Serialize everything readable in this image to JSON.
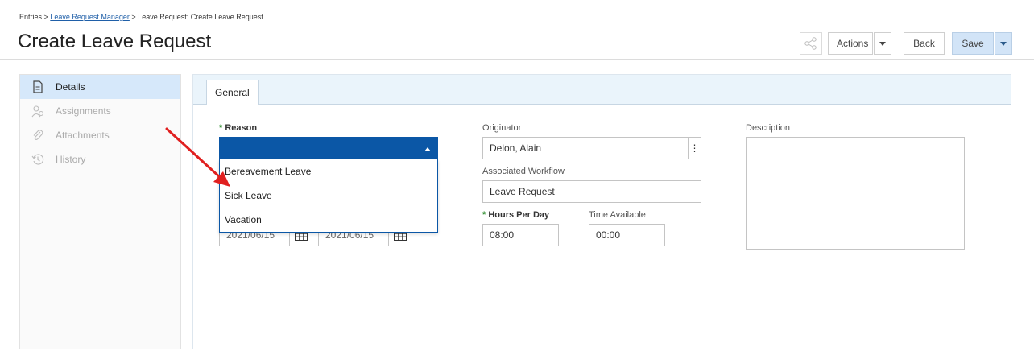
{
  "breadcrumb": {
    "root": "Entries",
    "sep": ">",
    "link": "Leave Request Manager",
    "current": "Leave Request: Create Leave Request"
  },
  "page": {
    "title": "Create Leave Request"
  },
  "toolbar": {
    "actions_label": "Actions",
    "back_label": "Back",
    "save_label": "Save"
  },
  "sidebar": {
    "items": [
      {
        "label": "Details",
        "icon": "document-icon",
        "active": true
      },
      {
        "label": "Assignments",
        "icon": "people-icon",
        "active": false
      },
      {
        "label": "Attachments",
        "icon": "paperclip-icon",
        "active": false
      },
      {
        "label": "History",
        "icon": "history-icon",
        "active": false
      }
    ]
  },
  "tabs": [
    {
      "label": "General"
    }
  ],
  "form": {
    "reason": {
      "label": "Reason",
      "required_mark": "*",
      "value": "",
      "options": [
        "Bereavement Leave",
        "Sick Leave",
        "Vacation"
      ]
    },
    "start_date": {
      "value": "2021/06/15"
    },
    "end_date": {
      "value": "2021/06/15"
    },
    "originator": {
      "label": "Originator",
      "value": "Delon, Alain"
    },
    "associated_workflow": {
      "label": "Associated Workflow",
      "value": "Leave Request"
    },
    "hours_per_day": {
      "label": "Hours Per Day",
      "required_mark": "*",
      "value": "08:00"
    },
    "time_available": {
      "label": "Time Available",
      "value": "00:00"
    },
    "description": {
      "label": "Description",
      "value": ""
    }
  },
  "colors": {
    "accent": "#0b57a6",
    "active_sidebar": "#d6e8fa",
    "annotation_arrow": "#e02020",
    "required": "#2a8a2a"
  }
}
